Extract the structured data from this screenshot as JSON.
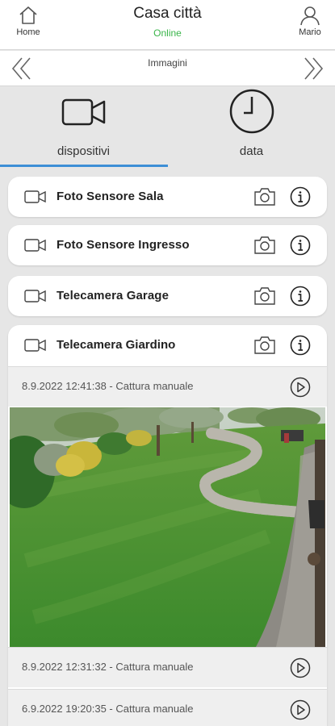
{
  "header": {
    "home_label": "Home",
    "title": "Casa città",
    "status": "Online",
    "user_label": "Mario"
  },
  "section": {
    "title": "Immagini"
  },
  "tabs": [
    {
      "label": "dispositivi",
      "icon": "video-camera-icon",
      "active": true
    },
    {
      "label": "data",
      "icon": "clock-icon",
      "active": false
    }
  ],
  "devices": [
    {
      "label": "Foto Sensore Sala"
    },
    {
      "label": "Foto Sensore Ingresso"
    },
    {
      "label": "Telecamera Garage"
    },
    {
      "label": "Telecamera Giardino",
      "expanded": true
    }
  ],
  "captures": [
    {
      "label": "8.9.2022 12:41:38 - Cattura manuale"
    },
    {
      "label": "8.9.2022 12:31:32 - Cattura manuale"
    },
    {
      "label": "6.9.2022 19:20:35 - Cattura manuale"
    }
  ],
  "colors": {
    "accent": "#3d8fd6",
    "online": "#3ab54a"
  }
}
